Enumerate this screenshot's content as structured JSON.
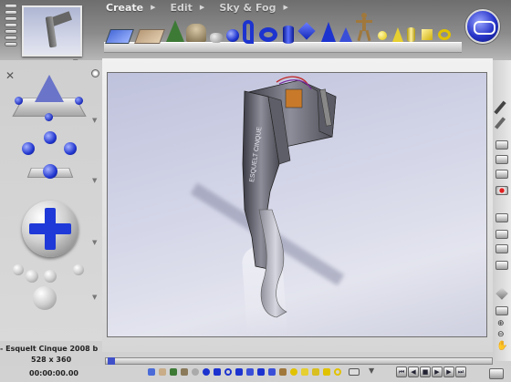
{
  "menu": {
    "create": "Create",
    "edit": "Edit",
    "sky_fog": "Sky & Fog"
  },
  "primitives": [
    "water-icon",
    "ground-icon",
    "tree-icon",
    "terrain-icon",
    "rock-icon",
    "sphere-icon",
    "torus-icon",
    "cylinder-icon",
    "cube-icon",
    "cone-icon",
    "pyramid-icon",
    "figure-icon",
    "light-icon",
    "cone-light-icon",
    "cube-light-icon"
  ],
  "status": {
    "filename": "- Esquelt Cinque 2008 b",
    "resolution": "528 x 360",
    "time": "00:00:00.00"
  },
  "colors": {
    "accent_blue": "#1e39d8",
    "viewport_bg": "#d4d6e8"
  }
}
